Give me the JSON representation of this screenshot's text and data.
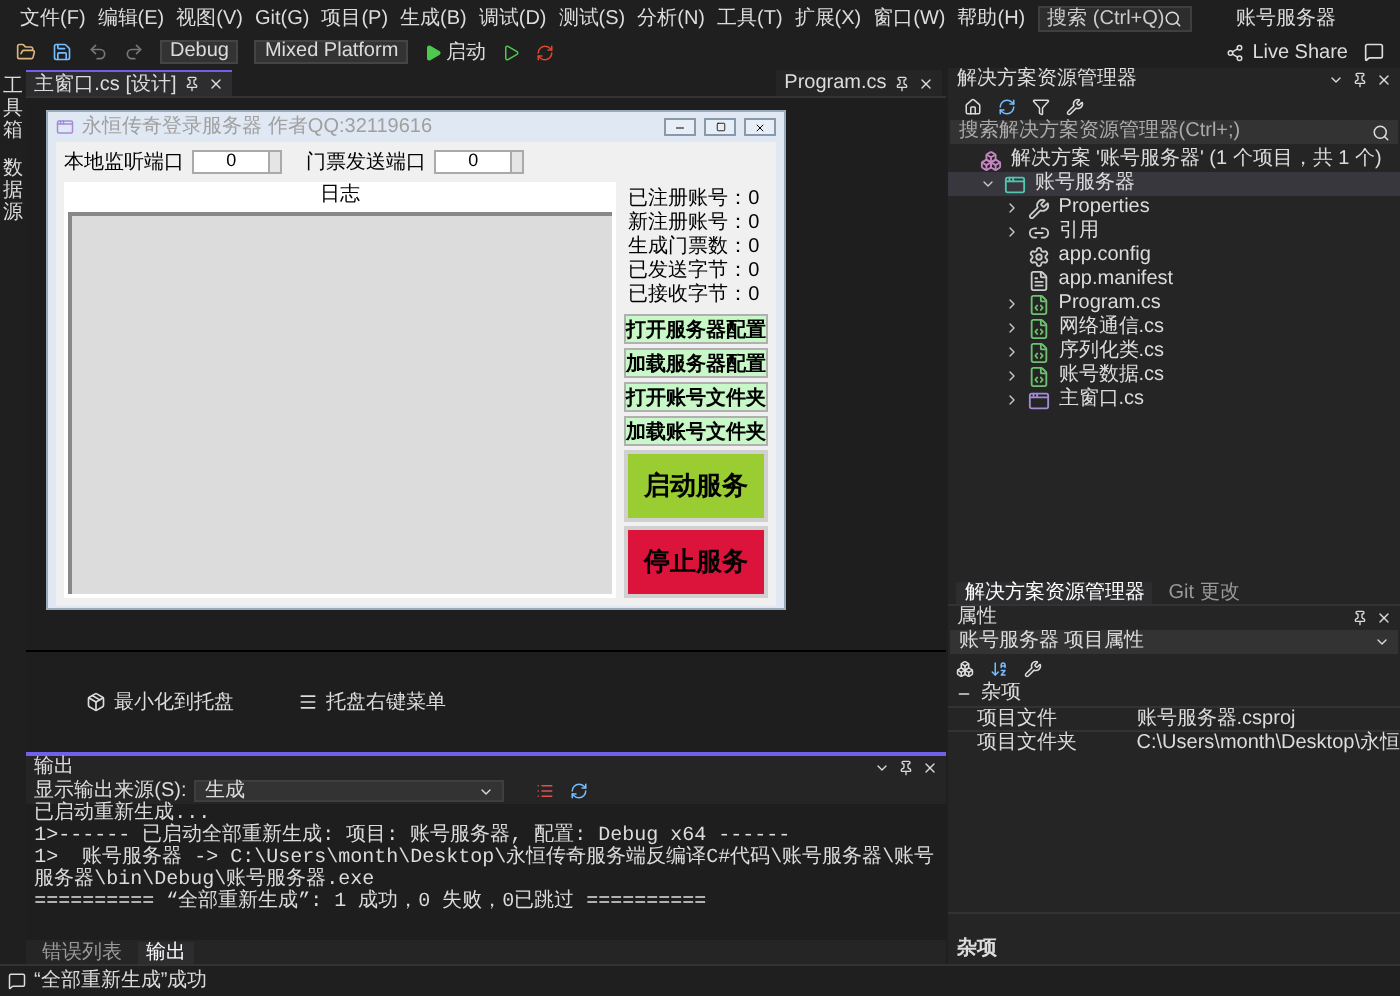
{
  "title_bar": {
    "menu": [
      "文件(F)",
      "编辑(E)",
      "视图(V)",
      "Git(G)",
      "项目(P)",
      "生成(B)",
      "调试(D)",
      "测试(S)",
      "分析(N)",
      "工具(T)",
      "扩展(X)",
      "窗口(W)",
      "帮助(H)"
    ],
    "search": {
      "placeholder": "搜索 (Ctrl+Q)"
    },
    "solution_name": "账号服务器"
  },
  "toolbar": {
    "configuration": "Debug",
    "platform": "Mixed Platform",
    "start": "启动",
    "live_share": "Live Share"
  },
  "side_strip": [
    "工具箱",
    "数据源"
  ],
  "document_tabs": [
    {
      "label": "主窗口.cs [设计]",
      "selected": true
    },
    {
      "label": "Program.cs",
      "selected": false
    }
  ],
  "form": {
    "title": "永恒传奇登录服务器 作者QQ:32119616",
    "ports": [
      {
        "label": "本地监听端口",
        "value": "0"
      },
      {
        "label": "门票发送端口",
        "value": "0"
      }
    ],
    "log_header": "日志",
    "stats": [
      "已注册账号：0",
      "新注册账号：0",
      "生成门票数：0",
      "已发送字节：0",
      "已接收字节：0"
    ],
    "buttons": [
      {
        "label": "打开服务器配置",
        "kind": "small"
      },
      {
        "label": "加载服务器配置",
        "kind": "small"
      },
      {
        "label": "打开账号文件夹",
        "kind": "small"
      },
      {
        "label": "加载账号文件夹",
        "kind": "small"
      },
      {
        "label": "启动服务",
        "kind": "start"
      },
      {
        "label": "停止服务",
        "kind": "stop"
      }
    ]
  },
  "component_tray": [
    {
      "label": "最小化到托盘",
      "kind": "tray"
    },
    {
      "label": "托盘右键菜单",
      "kind": "menu"
    }
  ],
  "solution_explorer": {
    "title": "解决方案资源管理器",
    "search": {
      "placeholder": "搜索解决方案资源管理器(Ctrl+;)"
    },
    "tree": [
      {
        "label": "解决方案 '账号服务器' (1 个项目，共 1 个)",
        "kind": "solution",
        "children": [
          {
            "label": "账号服务器",
            "kind": "project",
            "expanded": true,
            "selected": true,
            "children": [
              {
                "label": "Properties",
                "kind": "properties",
                "expanded": false,
                "selected": false
              },
              {
                "label": "引用",
                "kind": "references",
                "expanded": false,
                "selected": false
              },
              {
                "label": "app.config",
                "kind": "config",
                "selected": false
              },
              {
                "label": "app.manifest",
                "kind": "manifest",
                "selected": false
              },
              {
                "label": "Program.cs",
                "kind": "csharp",
                "expanded": false,
                "selected": false
              },
              {
                "label": "网络通信.cs",
                "kind": "csharp",
                "expanded": false,
                "selected": false
              },
              {
                "label": "序列化类.cs",
                "kind": "csharp",
                "expanded": false,
                "selected": false
              },
              {
                "label": "账号数据.cs",
                "kind": "csharp",
                "expanded": false,
                "selected": false
              },
              {
                "label": "主窗口.cs",
                "kind": "form",
                "expanded": false,
                "selected": false
              }
            ]
          }
        ]
      }
    ]
  },
  "panel_tabs": [
    {
      "label": "解决方案资源管理器",
      "selected": true
    },
    {
      "label": "Git 更改",
      "selected": false
    }
  ],
  "properties": {
    "title": "属性",
    "object": "账号服务器 项目属性",
    "category": "杂项",
    "rows": [
      {
        "name": "项目文件",
        "value": "账号服务器.csproj"
      },
      {
        "name": "项目文件夹",
        "value": "C:\\Users\\month\\Desktop\\永恒"
      }
    ],
    "description": "杂项"
  },
  "output": {
    "title": "输出",
    "source_label": "显示输出来源(S):",
    "source": "生成",
    "lines": [
      "已启动重新生成...",
      "1>------ 已启动全部重新生成: 项目: 账号服务器, 配置: Debug x64 ------",
      "1>  账号服务器 -> C:\\Users\\month\\Desktop\\永恒传奇服务端反编译C#代码\\账号服务器\\账号服务器\\bin\\Debug\\账号服务器.exe",
      "========== “全部重新生成”: 1 成功，0 失败，0已跳过 =========="
    ],
    "tabs": [
      {
        "label": "错误列表",
        "selected": false
      },
      {
        "label": "输出",
        "selected": true
      }
    ]
  },
  "status_bar": {
    "message": "“全部重新生成”成功"
  }
}
